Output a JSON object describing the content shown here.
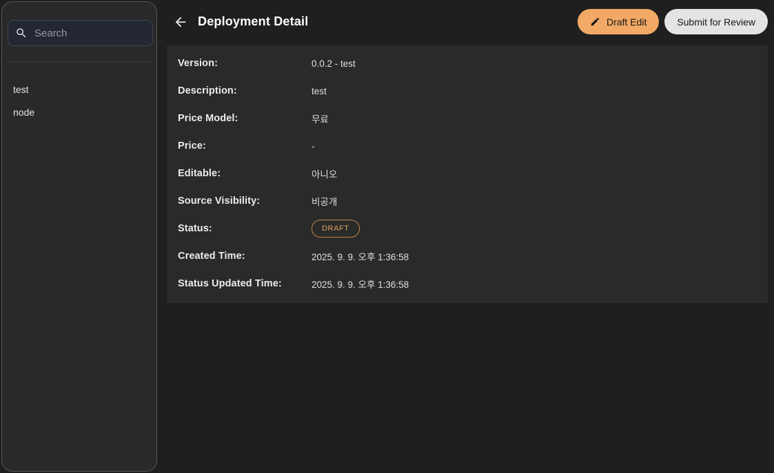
{
  "sidebar": {
    "search": {
      "placeholder": "Search",
      "icon": "magnifier-icon"
    },
    "items": [
      {
        "label": "test"
      },
      {
        "label": "node"
      }
    ]
  },
  "header": {
    "back_icon": "arrow-left-icon",
    "title": "Deployment Detail",
    "buttons": {
      "draft_edit": {
        "label": "Draft Edit",
        "icon": "pencil-icon",
        "bg": "#f2a965"
      },
      "submit_review": {
        "label": "Submit for Review",
        "bg": "#e4e4e4"
      }
    }
  },
  "detail": {
    "fields": [
      {
        "label": "Version:",
        "value": "0.0.2 - test"
      },
      {
        "label": "Description:",
        "value": "test"
      },
      {
        "label": "Price Model:",
        "value": "무료"
      },
      {
        "label": "Price:",
        "value": "-"
      },
      {
        "label": "Editable:",
        "value": "아니오"
      },
      {
        "label": "Source Visibility:",
        "value": "비공개"
      },
      {
        "label": "Status:",
        "value": "DRAFT",
        "type": "badge"
      },
      {
        "label": "Created Time:",
        "value": "2025. 9. 9. 오후 1:36:58"
      },
      {
        "label": "Status Updated Time:",
        "value": "2025. 9. 9. 오후 1:36:58"
      }
    ]
  },
  "colors": {
    "page_bg": "#1f1f1f",
    "sidebar_bg": "#292929",
    "panel_bg": "#2a2a2a",
    "accent_orange": "#f2a965",
    "badge_border": "#c08449",
    "badge_text": "#dda05c",
    "search_bg": "#222733"
  }
}
